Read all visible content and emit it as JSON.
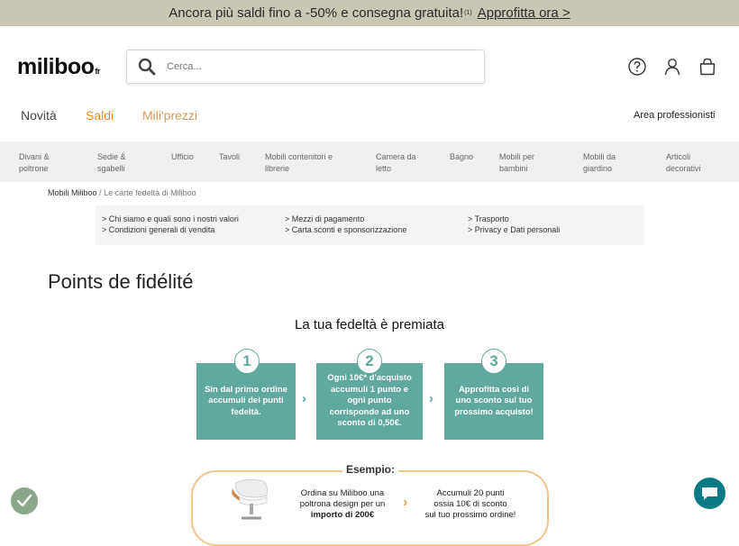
{
  "promo": {
    "text": "Ancora più saldi fino a -50% e consegna gratuita!",
    "mark": "(1)",
    "link": "Approfitta ora >"
  },
  "header": {
    "logo": "miliboo",
    "logo_suffix": "fr",
    "search_placeholder": "Cerca..."
  },
  "nav": {
    "items": [
      "Novità",
      "Saldi",
      "Mili'prezzi"
    ],
    "pro": "Area professionisti"
  },
  "categories": [
    [
      "Divani &",
      "poltrone"
    ],
    [
      "Sedie &",
      "sgabelli"
    ],
    [
      "Ufficio"
    ],
    [
      "Tavoli"
    ],
    [
      "Mobili contenitori e",
      "librerie"
    ],
    [
      "Camera da",
      "letto"
    ],
    [
      "Bagno"
    ],
    [
      "Mobili per",
      "bambini"
    ],
    [
      "Mobili da",
      "giardino"
    ],
    [
      "Articoli",
      "decorativi"
    ]
  ],
  "breadcrumb": {
    "home": "Mobili Miliboo",
    "sep": "/",
    "current": "Le carte fedeltà di Miliboo"
  },
  "info_links": [
    "> Chi siamo e quali sono i nostri valori",
    "> Condizioni generali di vendita",
    "> Mezzi di pagamento",
    "> Carta sconti e sponsorizzazione",
    "> Trasporto",
    "> Privacy e Dati personali"
  ],
  "page_title": "Points de fidélité",
  "banner": {
    "title": "La tua fedeltà è premiata",
    "steps": [
      {
        "num": "1",
        "text": "Sin dal primo ordine accumuli dei punti fedeltà."
      },
      {
        "num": "2",
        "text": "Ogni 10€* d'acquisto accumuli 1 punto e ogni punto corrisponde ad uno sconto di 0,50€."
      },
      {
        "num": "3",
        "text": "Approfitta così di uno sconto sul tuo prossimo acquisto!"
      }
    ],
    "example_label": "Esempio:",
    "example_left": [
      "Ordina su Miliboo una",
      "poltrona design per un",
      "importo di 200€"
    ],
    "example_right": [
      "Accumuli 20 punti",
      "ossia 10€ di sconto",
      "sul tuo prossimo ordine!"
    ]
  },
  "colors": {
    "promo_bg": "#c9c7b4",
    "sale": "#e48a1f",
    "teal": "#5fa99e",
    "example_border": "#f1c58c",
    "chat": "#0b7a83"
  }
}
